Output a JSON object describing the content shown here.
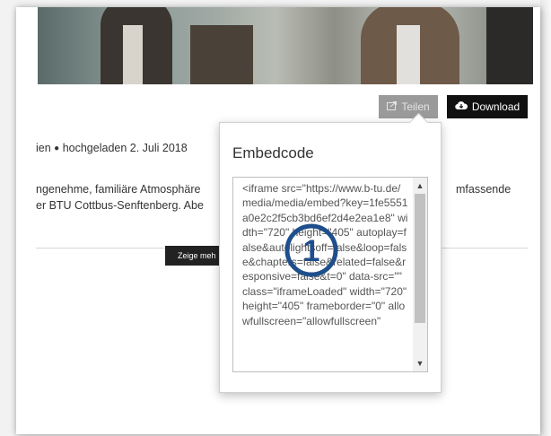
{
  "toolbar": {
    "share_label": "Teilen",
    "download_label": "Download"
  },
  "meta": {
    "prefix": "ien",
    "uploaded": "hochgeladen 2. Juli 2018"
  },
  "description": {
    "line1": "ngenehme, familiäre Atmosphäre",
    "line2": "er BTU Cottbus-Senftenberg. Abe",
    "line1_right": "mfassende"
  },
  "show_more_label": "Zeige meh",
  "embed": {
    "title": "Embedcode",
    "code": "<iframe src=\"https://www.b-tu.de/media/media/embed?key=1fe5551a0e2c2f5cb3bd6ef2d4e2ea1e8\" width=\"720\" height=\"405\" autoplay=false&autolightsoff=false&loop=false&chapters=false&related=false&responsive=false&t=0\" data-src=\"\" class=\"iframeLoaded\" width=\"720\" height=\"405\" frameborder=\"0\" allowfullscreen=\"allowfullscreen\""
  },
  "callout": {
    "number": "1",
    "color": "#1f4e8c"
  },
  "colors": {
    "share_bg": "#9a9a9a",
    "download_bg": "#111111"
  },
  "icons": {
    "share": "share-icon",
    "download": "cloud-download-icon",
    "scroll_up": "chevron-up-icon",
    "scroll_down": "chevron-down-icon"
  }
}
